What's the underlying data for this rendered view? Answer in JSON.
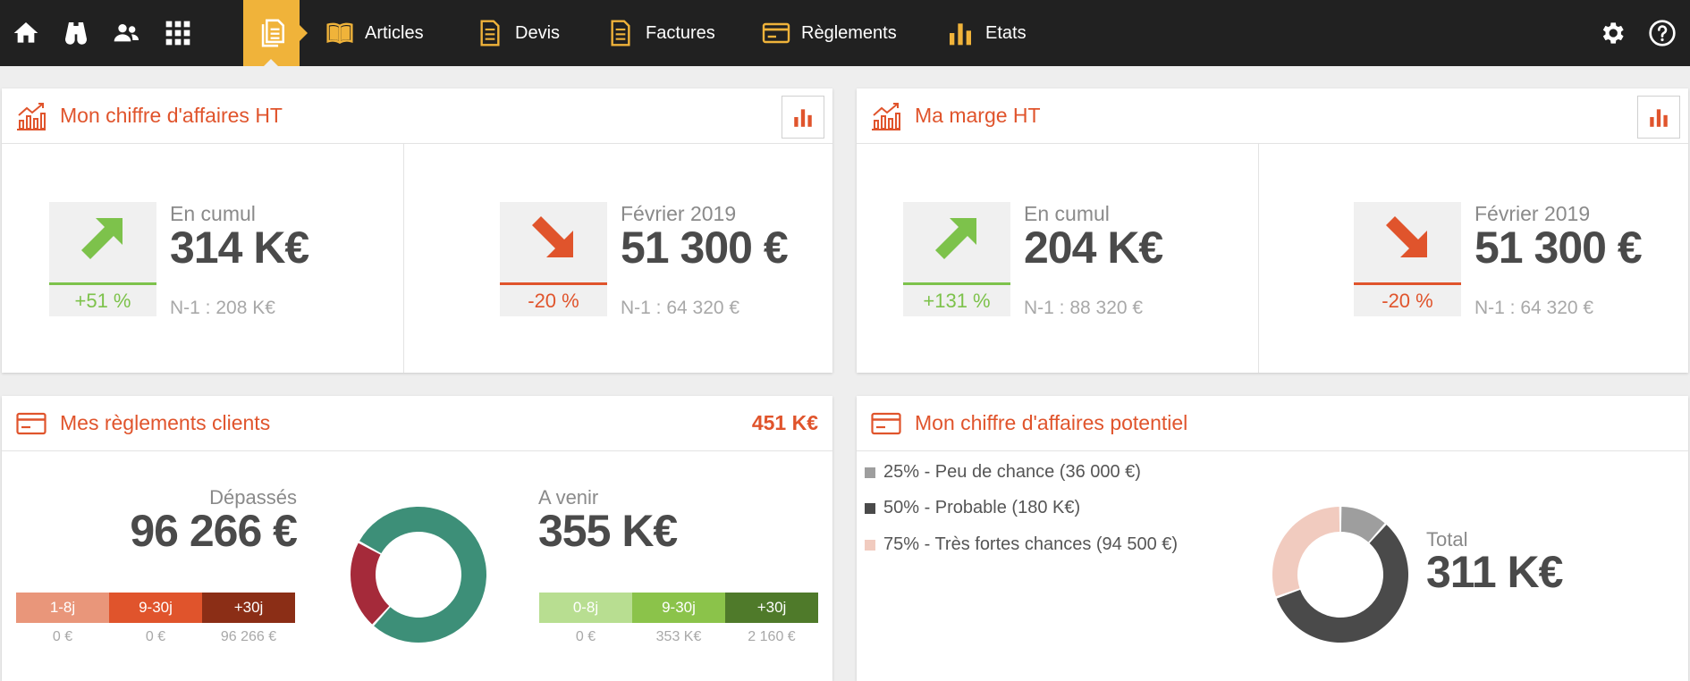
{
  "nav": {
    "items": [
      {
        "label": "Articles"
      },
      {
        "label": "Devis"
      },
      {
        "label": "Factures"
      },
      {
        "label": "Règlements"
      },
      {
        "label": "Etats"
      }
    ]
  },
  "colors": {
    "accent": "#e0542c",
    "nav_bg": "#212121",
    "nav_active": "#f0b33a",
    "up": "#7dc24b",
    "down": "#e0542c"
  },
  "ca": {
    "title": "Mon chiffre d'affaires HT",
    "cumul": {
      "label": "En cumul",
      "value": "314 K€",
      "pct": "+51 %",
      "prev": "N-1 : 208 K€"
    },
    "month": {
      "label": "Février 2019",
      "value": "51 300 €",
      "pct": "-20 %",
      "prev": "N-1 : 64 320 €"
    }
  },
  "marge": {
    "title": "Ma marge HT",
    "cumul": {
      "label": "En cumul",
      "value": "204 K€",
      "pct": "+131 %",
      "prev": "N-1 : 88 320 €"
    },
    "month": {
      "label": "Février 2019",
      "value": "51 300 €",
      "pct": "-20 %",
      "prev": "N-1 : 64 320 €"
    }
  },
  "reglements": {
    "title": "Mes règlements clients",
    "total": "451 K€",
    "overdue": {
      "label": "Dépassés",
      "value": "96 266 €",
      "segments": [
        {
          "label": "1-8j",
          "value": "0 €",
          "color": "#e9967a"
        },
        {
          "label": "9-30j",
          "value": "0 €",
          "color": "#e0542c"
        },
        {
          "label": "+30j",
          "value": "96 266 €",
          "color": "#8b2e16"
        }
      ]
    },
    "upcoming": {
      "label": "A venir",
      "value": "355 K€",
      "segments": [
        {
          "label": "0-8j",
          "value": "0 €",
          "color": "#b8de91"
        },
        {
          "label": "9-30j",
          "value": "353 K€",
          "color": "#8bc34a"
        },
        {
          "label": "+30j",
          "value": "2 160 €",
          "color": "#4f7a2a"
        }
      ]
    },
    "donut": [
      {
        "value": 96266,
        "color": "#a52a3a"
      },
      {
        "value": 355160,
        "color": "#3d8f78"
      }
    ]
  },
  "potentiel": {
    "title": "Mon chiffre d'affaires potentiel",
    "legend": [
      {
        "label": "25% - Peu de chance (36 000 €)",
        "color": "#9e9e9e"
      },
      {
        "label": "50% - Probable (180 K€)",
        "color": "#4a4a4a"
      },
      {
        "label": "75% - Très fortes chances (94 500 €)",
        "color": "#f1cbbf"
      }
    ],
    "total_label": "Total",
    "total_value": "311 K€",
    "donut": [
      {
        "value": 36000,
        "color": "#9e9e9e"
      },
      {
        "value": 180000,
        "color": "#4a4a4a"
      },
      {
        "value": 94500,
        "color": "#f1cbbf"
      }
    ]
  }
}
